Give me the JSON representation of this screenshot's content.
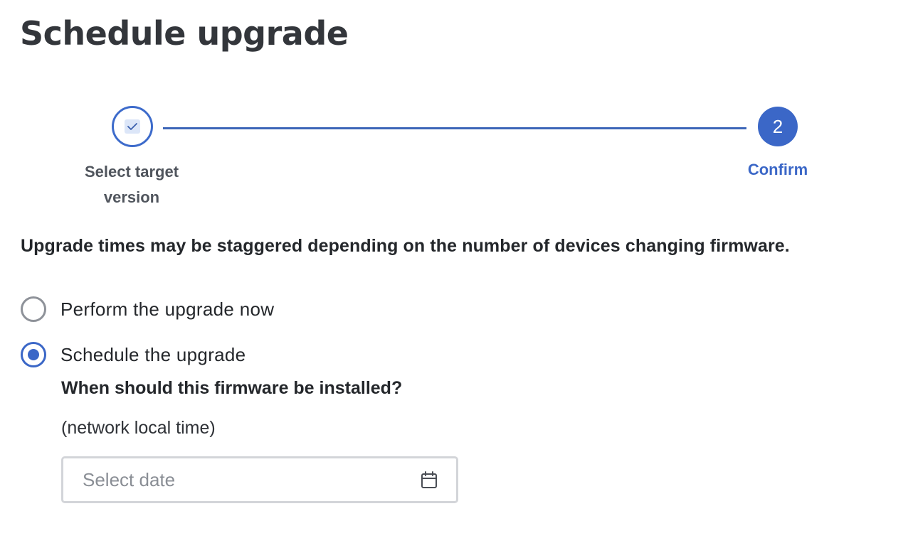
{
  "header": {
    "title": "Schedule upgrade"
  },
  "stepper": {
    "steps": [
      {
        "label_line1": "Select target",
        "label_line2": "version",
        "state": "completed",
        "icon": "check-icon"
      },
      {
        "number": "2",
        "label": "Confirm",
        "state": "active"
      }
    ],
    "accent_color": "#3b67c7"
  },
  "content": {
    "notice": "Upgrade times may be staggered depending on the number of devices changing firmware.",
    "options": [
      {
        "label": "Perform the upgrade now",
        "selected": false
      },
      {
        "label": "Schedule the upgrade",
        "selected": true
      }
    ],
    "question": "When should this firmware be installed?",
    "timezone_note": "(network local time)",
    "date_field": {
      "value": "",
      "placeholder": "Select date",
      "icon": "calendar-icon"
    }
  }
}
